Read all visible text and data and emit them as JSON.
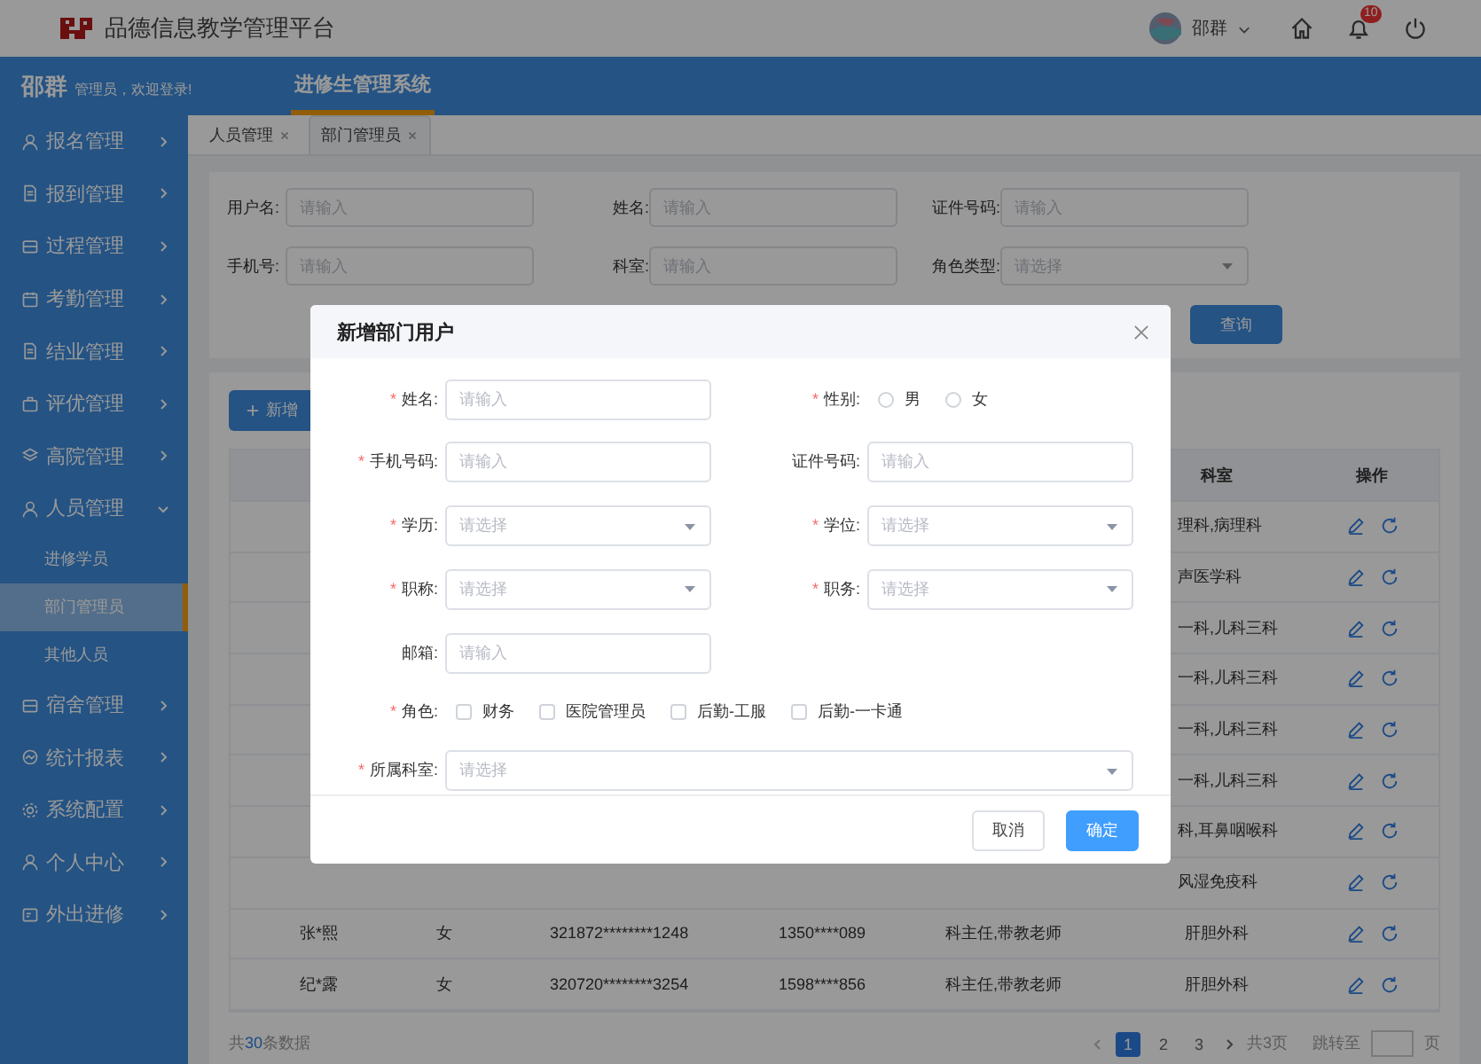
{
  "header": {
    "title": "品德信息教学管理平台",
    "user_name": "邵群",
    "notification_count": "10"
  },
  "topbar": {
    "user_name": "邵群",
    "greeting": "管理员，欢迎登录!",
    "system_tabs": [
      {
        "label": "进修生管理系统",
        "selected": true
      }
    ]
  },
  "sidebar": {
    "items": [
      {
        "label": "报名管理",
        "expanded": false
      },
      {
        "label": "报到管理",
        "expanded": false
      },
      {
        "label": "过程管理",
        "expanded": false
      },
      {
        "label": "考勤管理",
        "expanded": false
      },
      {
        "label": "结业管理",
        "expanded": false
      },
      {
        "label": "评优管理",
        "expanded": false
      },
      {
        "label": "高院管理",
        "expanded": false
      },
      {
        "label": "人员管理",
        "expanded": true,
        "children": [
          {
            "label": "进修学员",
            "selected": false
          },
          {
            "label": "部门管理员",
            "selected": true
          },
          {
            "label": "其他人员",
            "selected": false
          }
        ]
      },
      {
        "label": "宿舍管理",
        "expanded": false
      },
      {
        "label": "统计报表",
        "expanded": false
      },
      {
        "label": "系统配置",
        "expanded": false
      },
      {
        "label": "个人中心",
        "expanded": false
      },
      {
        "label": "外出进修",
        "expanded": false
      }
    ]
  },
  "tabs": [
    {
      "label": "人员管理",
      "selected": false
    },
    {
      "label": "部门管理员",
      "selected": true
    }
  ],
  "filters": [
    {
      "label": "用户名:",
      "kind": "input",
      "placeholder": "请输入"
    },
    {
      "label": "姓名:",
      "kind": "input",
      "placeholder": "请输入"
    },
    {
      "label": "证件号码:",
      "kind": "input",
      "placeholder": "请输入"
    },
    {
      "label": "手机号:",
      "kind": "input",
      "placeholder": "请输入"
    },
    {
      "label": "科室:",
      "kind": "input",
      "placeholder": "请输入"
    },
    {
      "label": "角色类型:",
      "kind": "select",
      "placeholder": "请选择"
    }
  ],
  "search_button": "查询",
  "new_button": "新增",
  "table": {
    "columns": [
      {
        "label": "科室"
      },
      {
        "label": "操作"
      }
    ],
    "rows": [
      {
        "department": "理科,病理科"
      },
      {
        "department": "声医学科"
      },
      {
        "department": "一科,儿科三科"
      },
      {
        "department": "一科,儿科三科"
      },
      {
        "department": "一科,儿科三科"
      },
      {
        "department": "一科,儿科三科"
      },
      {
        "department": "科,耳鼻咽喉科"
      },
      {
        "department": "风湿免疫科"
      },
      {
        "name": "张*熙",
        "gender": "女",
        "id_number": "321872********1248",
        "phone": "1350****089",
        "role": "科主任,带教老师",
        "department": "肝胆外科"
      },
      {
        "name": "纪*露",
        "gender": "女",
        "id_number": "320720********3254",
        "phone": "1598****856",
        "role": "科主任,带教老师",
        "department": "肝胆外科"
      }
    ]
  },
  "total": {
    "prefix": "共",
    "count": "30",
    "suffix": "条数据"
  },
  "pagination": {
    "pages": [
      {
        "label": "1",
        "selected": true
      },
      {
        "label": "2",
        "selected": false
      },
      {
        "label": "3",
        "selected": false
      }
    ],
    "page_count": "共3页",
    "jump_label": "跳转至",
    "jump_suffix": "页"
  },
  "modal": {
    "title": "新增部门用户",
    "fields": [
      {
        "label": "姓名:",
        "marker": "*",
        "kind": "input",
        "placeholder": "请输入",
        "full_width": false
      },
      {
        "label": "性别:",
        "marker": "*",
        "kind": "radio",
        "full_width": false,
        "options": [
          {
            "label": "男",
            "selected": false
          },
          {
            "label": "女",
            "selected": false
          }
        ]
      },
      {
        "label": "手机号码:",
        "marker": "*",
        "kind": "input",
        "placeholder": "请输入",
        "full_width": false
      },
      {
        "label": "证件号码:",
        "kind": "input",
        "placeholder": "请输入",
        "full_width": false
      },
      {
        "label": "学历:",
        "marker": "*",
        "kind": "select",
        "placeholder": "请选择",
        "full_width": false
      },
      {
        "label": "学位:",
        "marker": "*",
        "kind": "select",
        "placeholder": "请选择",
        "full_width": false
      },
      {
        "label": "职称:",
        "marker": "*",
        "kind": "select",
        "placeholder": "请选择",
        "full_width": false
      },
      {
        "label": "职务:",
        "marker": "*",
        "kind": "select",
        "placeholder": "请选择",
        "full_width": false
      },
      {
        "label": "邮箱:",
        "kind": "input",
        "placeholder": "请输入",
        "full_width": false
      },
      {
        "label": "角色:",
        "marker": "*",
        "kind": "checkbox",
        "full_width": true,
        "options": [
          {
            "label": "财务",
            "checked": false
          },
          {
            "label": "医院管理员",
            "checked": false
          },
          {
            "label": "后勤-工服",
            "checked": false
          },
          {
            "label": "后勤-一卡通",
            "checked": false
          }
        ]
      },
      {
        "label": "所属科室:",
        "marker": "*",
        "kind": "select",
        "placeholder": "请选择",
        "full_width": true
      }
    ],
    "buttons": [
      {
        "label": "取消",
        "kind": "default"
      },
      {
        "label": "确定",
        "kind": "primary"
      }
    ]
  }
}
